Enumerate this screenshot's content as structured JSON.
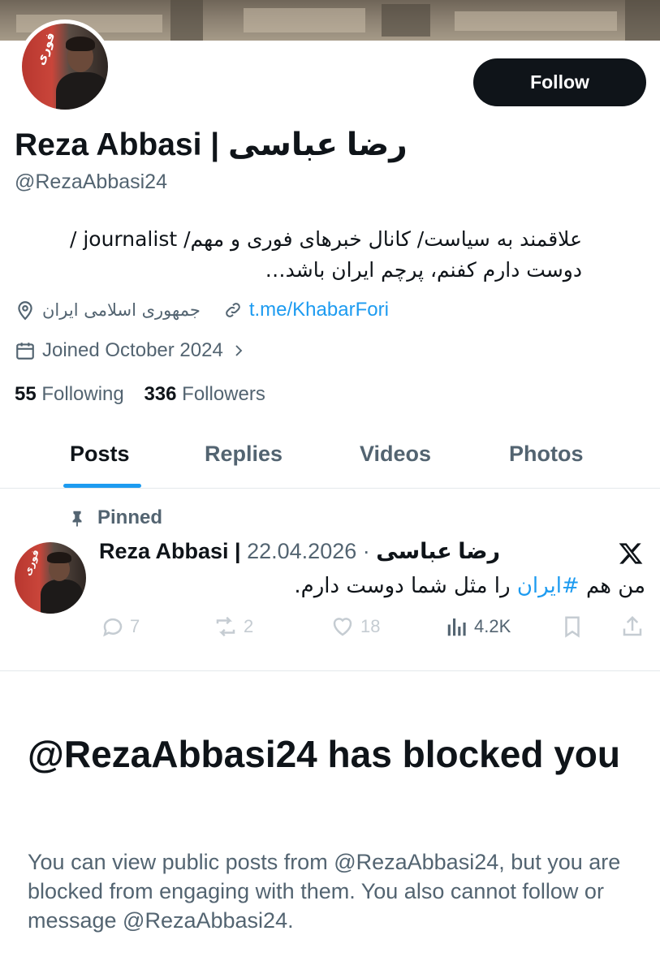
{
  "profile": {
    "display_name": "Reza Abbasi | رضا عباسی",
    "handle": "@RezaAbbasi24",
    "follow_label": "Follow",
    "bio_line1": "علاقمند به سیاست/ کانال خبرهای فوری و مهم/ journalist /",
    "bio_line2": "دوست دارم کفنم، پرچم ایران باشد…",
    "location": "جمهوری اسلامی ایران",
    "link": "t.me/KhabarFori",
    "joined": "Joined October 2024",
    "following_count": "55",
    "following_label": "Following",
    "followers_count": "336",
    "followers_label": "Followers",
    "avatar_logo_text": "فوری"
  },
  "tabs": [
    {
      "label": "Posts",
      "active": true
    },
    {
      "label": "Replies",
      "active": false
    },
    {
      "label": "Videos",
      "active": false
    },
    {
      "label": "Photos",
      "active": false
    }
  ],
  "pinned_post": {
    "pinned_label": "Pinned",
    "author": "Reza Abbasi | رضا عباسی",
    "date": "· 22.04.2026",
    "text_before": "من هم ",
    "hashtag": "#ایران",
    "text_after": " را مثل شما دوست دارم.",
    "replies": "7",
    "reposts": "2",
    "likes": "18",
    "views": "4.2K"
  },
  "blocked": {
    "title": "@RezaAbbasi24 has blocked you",
    "description": "You can view public posts from @RezaAbbasi24, but you are blocked from engaging with them. You also cannot follow or message @RezaAbbasi24."
  },
  "colors": {
    "accent": "#1d9bf0",
    "text_primary": "#0f1419",
    "text_secondary": "#536471",
    "disabled": "#c5ccd2"
  },
  "icons": [
    "location-pin-icon",
    "link-icon",
    "calendar-icon",
    "chevron-right-icon",
    "pin-icon",
    "x-logo-icon",
    "reply-icon",
    "repost-icon",
    "like-icon",
    "views-icon",
    "bookmark-icon",
    "share-icon"
  ]
}
